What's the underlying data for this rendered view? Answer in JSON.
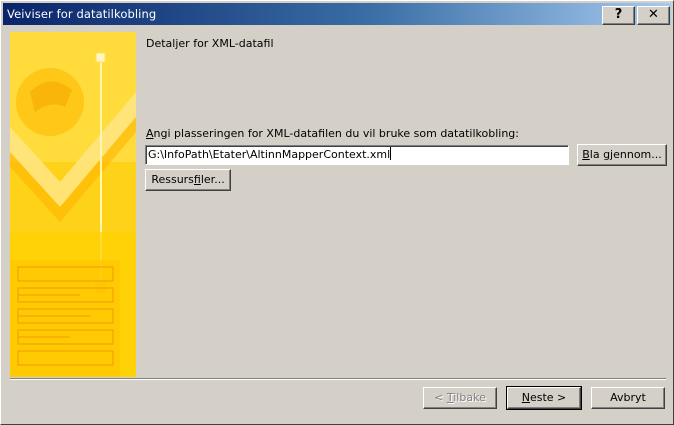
{
  "window": {
    "title": "Veiviser for datatilkobling"
  },
  "titlebar": {
    "help_glyph": "?",
    "close_glyph": "✕"
  },
  "content": {
    "heading": "Detaljer for XML-datafil",
    "prompt_first": "A",
    "prompt_rest": "ngi plasseringen for XML-datafilen du vil bruke som datatilkobling:",
    "path_value": "G:\\InfoPath\\Etater\\AltinnMapperContext.xml"
  },
  "buttons": {
    "browse_pre": "B",
    "browse_rest": "la gjennom...",
    "resources_pre": "Ressurs",
    "resources_u": "f",
    "resources_rest": "iler...",
    "back_pre": "< ",
    "back_u": "T",
    "back_rest": "ilbake",
    "next_u": "N",
    "next_rest": "este >",
    "cancel": "Avbryt"
  },
  "colors": {
    "titlebar_start": "#0a246a",
    "titlebar_end": "#a6caf0",
    "dialog_bg": "#d4d0c8",
    "banner_yellow": "#ffd21a"
  }
}
